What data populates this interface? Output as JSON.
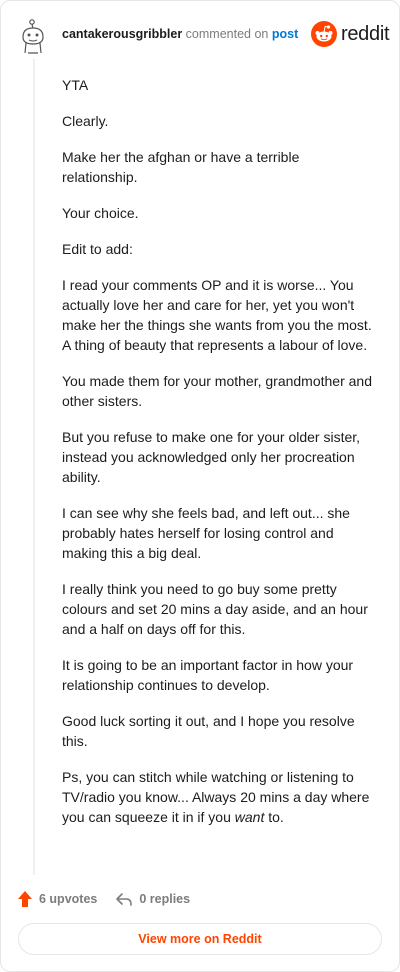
{
  "header": {
    "username": "cantakerousgribbler",
    "commented_text": "commented on",
    "post_link": "post",
    "brand": "reddit"
  },
  "comment": {
    "paragraphs": [
      "YTA",
      "Clearly.",
      "Make her the afghan or have a terrible relationship.",
      "Your choice.",
      "Edit to add:",
      "I read your comments OP and it is worse... You actually love her and care for her, yet you won't make her the things she wants from you the most. A thing of beauty that represents a labour of love.",
      "You made them for your mother, grandmother and other sisters.",
      "But you refuse to make one for your older sister, instead you acknowledged only her procreation ability.",
      "I can see why she feels bad, and left out... she probably hates herself for losing control and making this a big deal.",
      "I really think you need to go buy some pretty colours and set 20 mins a day aside, and an hour and a half on days off for this.",
      "It is going to be an important factor in how your relationship continues to develop.",
      "Good luck sorting it out, and I hope you resolve this."
    ],
    "last_paragraph": {
      "before": "Ps, you can stitch while watching or listening to TV/radio you know... Always 20 mins a day where you can squeeze it in if you ",
      "emphasis": "want",
      "after": " to."
    }
  },
  "footer": {
    "upvotes": "6 upvotes",
    "replies": "0 replies",
    "view_more": "View more on Reddit"
  },
  "colors": {
    "accent": "#ff4500",
    "link": "#0079d3",
    "muted": "#7c7c7c"
  },
  "icons": {
    "avatar": "snoo-avatar-icon",
    "brand": "reddit-logo-icon",
    "upvote": "upvote-arrow-icon",
    "reply": "reply-arrow-icon"
  }
}
